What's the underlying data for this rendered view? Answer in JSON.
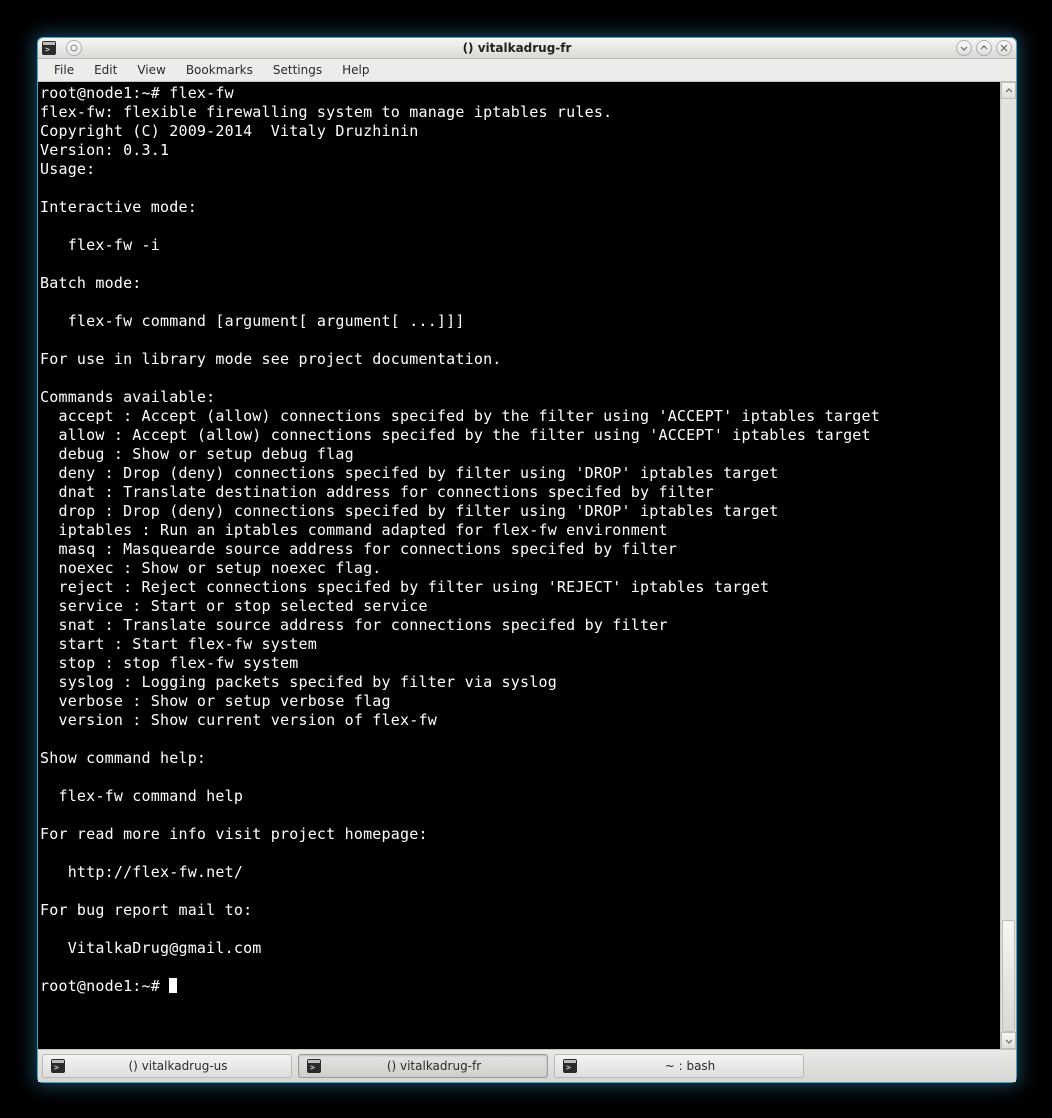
{
  "window": {
    "title": "() vitalkadrug-fr"
  },
  "menu": {
    "file": "File",
    "edit": "Edit",
    "view": "View",
    "bookmarks": "Bookmarks",
    "settings": "Settings",
    "help": "Help"
  },
  "terminal": {
    "prompt1": "root@node1:~# ",
    "cmd1": "flex-fw",
    "l1": "flex-fw: flexible firewalling system to manage iptables rules.",
    "l2": "Copyright (C) 2009-2014  Vitaly Druzhinin",
    "l3": "Version: 0.3.1",
    "l4": "Usage:",
    "l5": "",
    "l6": "Interactive mode:",
    "l7": "",
    "l8": "   flex-fw -i",
    "l9": "",
    "l10": "Batch mode:",
    "l11": "",
    "l12": "   flex-fw command [argument[ argument[ ...]]]",
    "l13": "",
    "l14": "For use in library mode see project documentation.",
    "l15": "",
    "l16": "Commands available:",
    "l17": "  accept : Accept (allow) connections specifed by the filter using 'ACCEPT' iptables target",
    "l18": "  allow : Accept (allow) connections specifed by the filter using 'ACCEPT' iptables target",
    "l19": "  debug : Show or setup debug flag",
    "l20": "  deny : Drop (deny) connections specifed by filter using 'DROP' iptables target",
    "l21": "  dnat : Translate destination address for connections specifed by filter",
    "l22": "  drop : Drop (deny) connections specifed by filter using 'DROP' iptables target",
    "l23": "  iptables : Run an iptables command adapted for flex-fw environment",
    "l24": "  masq : Masquearde source address for connections specifed by filter",
    "l25": "  noexec : Show or setup noexec flag.",
    "l26": "  reject : Reject connections specifed by filter using 'REJECT' iptables target",
    "l27": "  service : Start or stop selected service",
    "l28": "  snat : Translate source address for connections specifed by filter",
    "l29": "  start : Start flex-fw system",
    "l30": "  stop : stop flex-fw system",
    "l31": "  syslog : Logging packets specifed by filter via syslog",
    "l32": "  verbose : Show or setup verbose flag",
    "l33": "  version : Show current version of flex-fw",
    "l34": "",
    "l35": "Show command help:",
    "l36": "",
    "l37": "  flex-fw command help",
    "l38": "",
    "l39": "For read more info visit project homepage:",
    "l40": "",
    "l41": "   http://flex-fw.net/",
    "l42": "",
    "l43": "For bug report mail to:",
    "l44": "",
    "l45": "   VitalkaDrug@gmail.com",
    "l46": "",
    "prompt2": "root@node1:~# "
  },
  "taskbar": {
    "t1": "() vitalkadrug-us",
    "t2": "() vitalkadrug-fr",
    "t3": "~ : bash"
  }
}
